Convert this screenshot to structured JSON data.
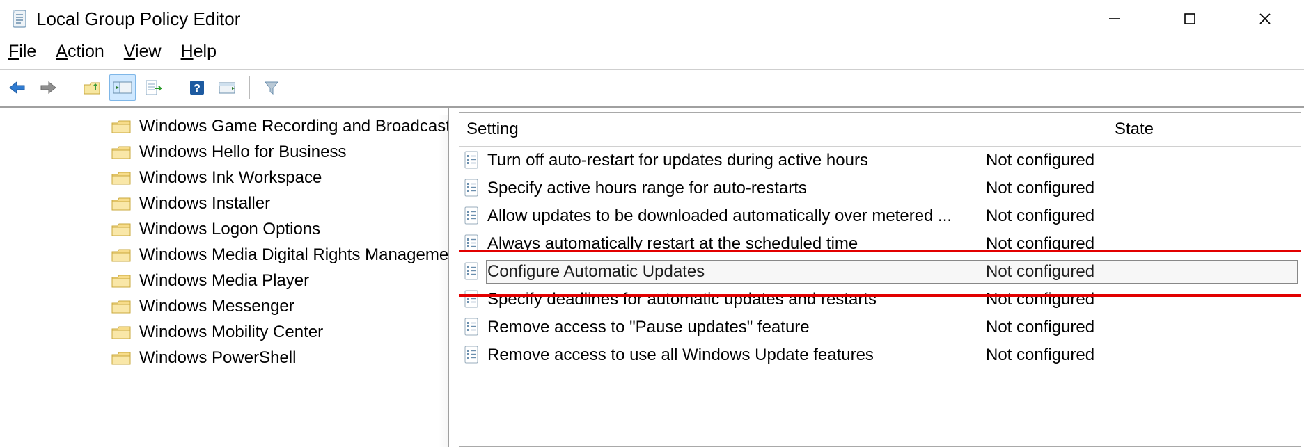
{
  "window": {
    "title": "Local Group Policy Editor"
  },
  "menu": {
    "file": "File",
    "action": "Action",
    "view": "View",
    "help": "Help"
  },
  "toolbar": {
    "back": "back-arrow-icon",
    "forward": "forward-arrow-icon",
    "up": "up-folder-icon",
    "show_hide": "show-hide-tree-icon",
    "export": "export-list-icon",
    "help": "help-icon",
    "properties": "properties-icon",
    "filter": "filter-icon"
  },
  "tree": {
    "items": [
      {
        "label": "Windows Game Recording and Broadcasting"
      },
      {
        "label": "Windows Hello for Business"
      },
      {
        "label": "Windows Ink Workspace"
      },
      {
        "label": "Windows Installer"
      },
      {
        "label": "Windows Logon Options"
      },
      {
        "label": "Windows Media Digital Rights Management"
      },
      {
        "label": "Windows Media Player"
      },
      {
        "label": "Windows Messenger"
      },
      {
        "label": "Windows Mobility Center"
      },
      {
        "label": "Windows PowerShell"
      }
    ]
  },
  "list": {
    "columns": {
      "setting": "Setting",
      "state": "State"
    },
    "rows": [
      {
        "setting": "Turn off auto-restart for updates during active hours",
        "state": "Not configured",
        "selected": false
      },
      {
        "setting": "Specify active hours range for auto-restarts",
        "state": "Not configured",
        "selected": false
      },
      {
        "setting": "Allow updates to be downloaded automatically over metered ...",
        "state": "Not configured",
        "selected": false
      },
      {
        "setting": "Always automatically restart at the scheduled time",
        "state": "Not configured",
        "selected": false
      },
      {
        "setting": "Configure Automatic Updates",
        "state": "Not configured",
        "selected": true
      },
      {
        "setting": "Specify deadlines for automatic updates and restarts",
        "state": "Not configured",
        "selected": false
      },
      {
        "setting": "Remove access to \"Pause updates\" feature",
        "state": "Not configured",
        "selected": false
      },
      {
        "setting": "Remove access to use all Windows Update features",
        "state": "Not configured",
        "selected": false
      }
    ]
  }
}
